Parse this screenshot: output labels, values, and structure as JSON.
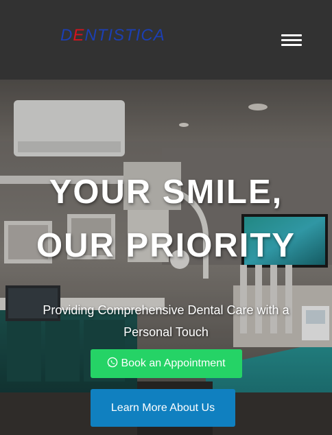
{
  "header": {
    "logo": {
      "first_letter": "D",
      "accent_letter": "E",
      "rest": "NTISTICA"
    },
    "menu_icon": "hamburger-menu-icon"
  },
  "hero": {
    "title_line1": "YOUR SMILE,",
    "title_line2": "OUR PRIORITY",
    "subtitle": "Providing Comprehensive Dental Care with a Personal Touch",
    "book_button": {
      "label": "Book an Appointment",
      "icon": "whatsapp-icon"
    },
    "learn_button": {
      "label": "Learn More About Us"
    }
  },
  "colors": {
    "header_bg": "#323232",
    "logo_blue": "#1c3fb3",
    "logo_red": "#d4141e",
    "book_button": "#25d366",
    "learn_button": "#1080c0"
  }
}
